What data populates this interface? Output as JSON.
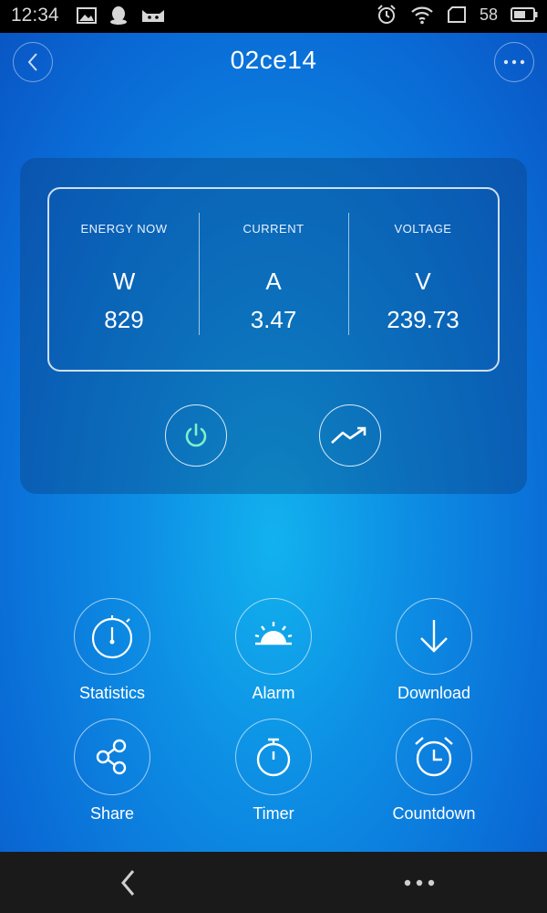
{
  "status_bar": {
    "time": "12:34",
    "battery": "58"
  },
  "header": {
    "title": "02ce14"
  },
  "readings": [
    {
      "label": "ENERGY NOW",
      "unit": "W",
      "value": "829"
    },
    {
      "label": "CURRENT",
      "unit": "A",
      "value": "3.47"
    },
    {
      "label": "VOLTAGE",
      "unit": "V",
      "value": "239.73"
    }
  ],
  "controls": {
    "power_icon": "power-icon",
    "trend_icon": "trend-icon",
    "power_color": "#7ff0c8"
  },
  "features": [
    {
      "label": "Statistics",
      "icon": "stopwatch-icon"
    },
    {
      "label": "Alarm",
      "icon": "sunrise-icon"
    },
    {
      "label": "Download",
      "icon": "arrow-down-icon"
    },
    {
      "label": "Share",
      "icon": "share-icon"
    },
    {
      "label": "Timer",
      "icon": "timer-icon"
    },
    {
      "label": "Countdown",
      "icon": "alarm-clock-icon"
    }
  ]
}
